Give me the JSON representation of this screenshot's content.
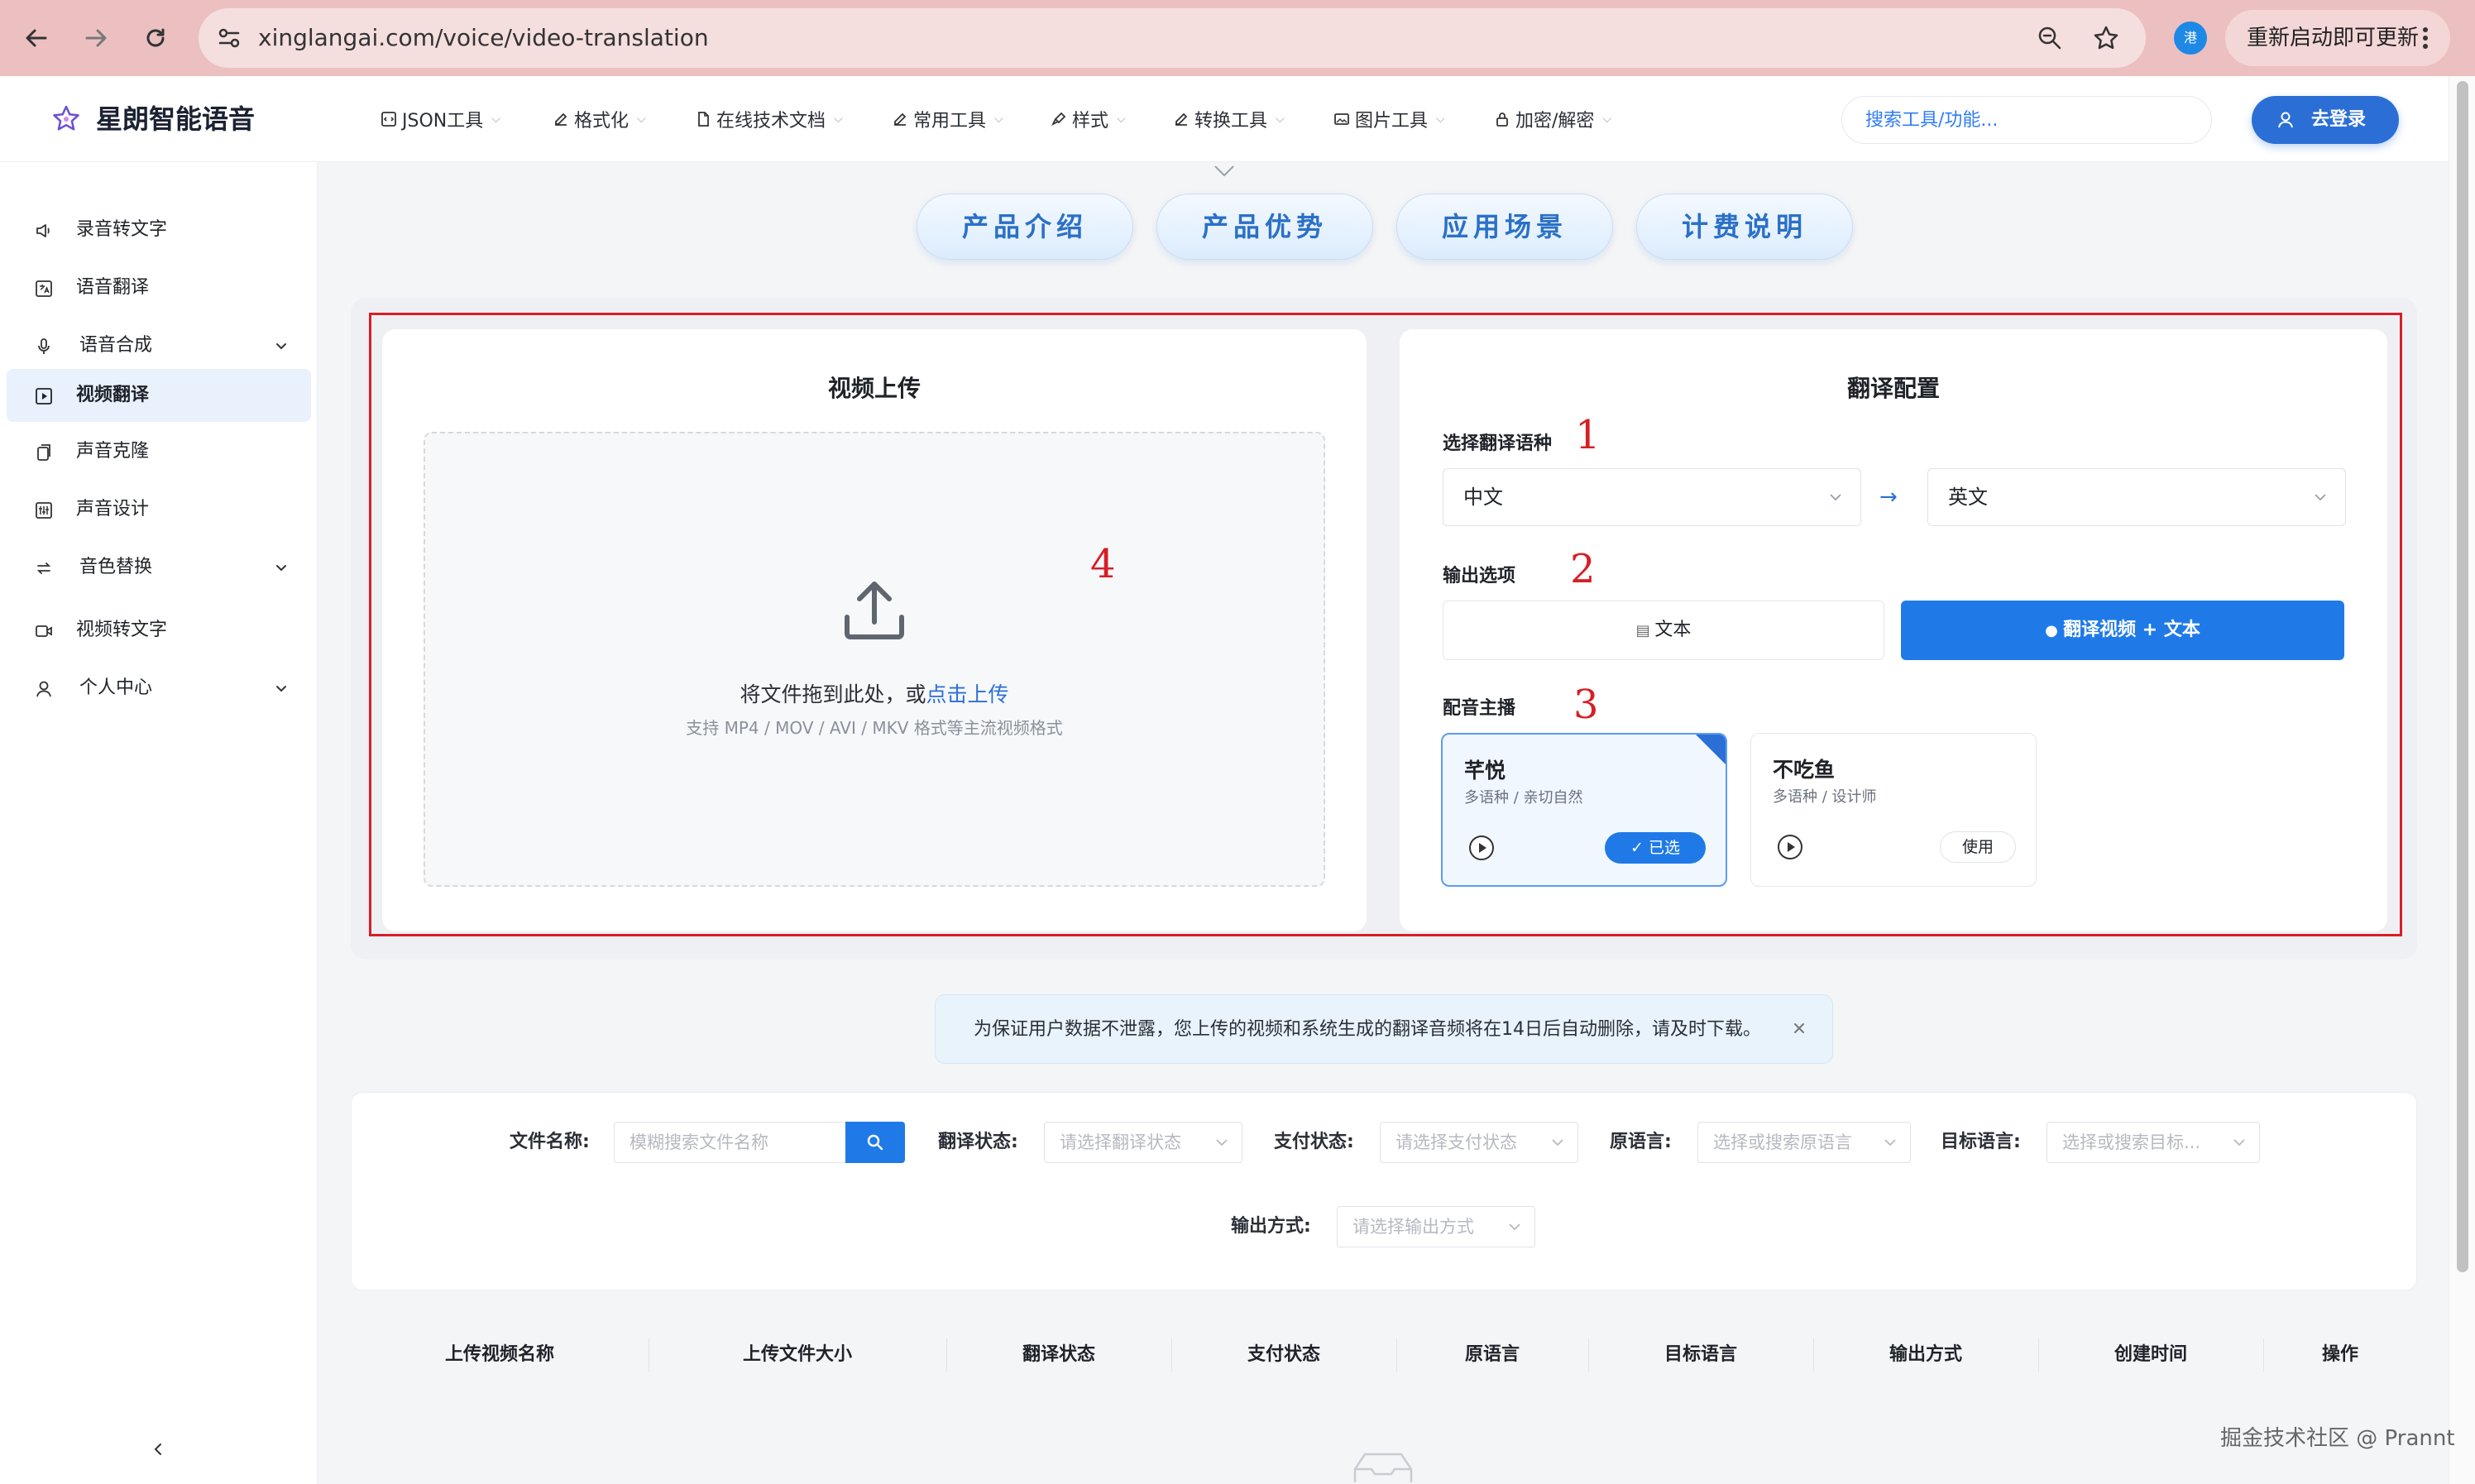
{
  "browser": {
    "url": "xinglangai.com/voice/video-translation",
    "update_button": "重新启动即可更新",
    "profile_initial": "港"
  },
  "header": {
    "brand": "星朗智能语音",
    "menu": [
      {
        "label": "JSON工具",
        "icon": "code-box-icon"
      },
      {
        "label": "格式化",
        "icon": "edit-icon"
      },
      {
        "label": "在线技术文档",
        "icon": "document-icon"
      },
      {
        "label": "常用工具",
        "icon": "edit-icon"
      },
      {
        "label": "样式",
        "icon": "brush-icon"
      },
      {
        "label": "转换工具",
        "icon": "edit-icon"
      },
      {
        "label": "图片工具",
        "icon": "image-icon"
      },
      {
        "label": "加密/解密",
        "icon": "lock-icon"
      }
    ],
    "search_placeholder": "搜索工具/功能...",
    "login": "去登录"
  },
  "sidebar": {
    "items": [
      {
        "label": "录音转文字",
        "icon": "speaker-icon"
      },
      {
        "label": "语音翻译",
        "icon": "translate-icon"
      },
      {
        "label": "语音合成",
        "icon": "microphone-icon",
        "expandable": true
      },
      {
        "label": "视频翻译",
        "icon": "video-play-icon",
        "active": true
      },
      {
        "label": "声音克隆",
        "icon": "copy-icon"
      },
      {
        "label": "声音设计",
        "icon": "sliders-icon"
      },
      {
        "label": "音色替换",
        "icon": "swap-icon",
        "expandable": true
      },
      {
        "label": "视频转文字",
        "icon": "video-camera-icon"
      },
      {
        "label": "个人中心",
        "icon": "user-icon",
        "expandable": true
      }
    ]
  },
  "tabs": [
    "产品介绍",
    "产品优势",
    "应用场景",
    "计费说明"
  ],
  "upload": {
    "title": "视频上传",
    "drop_text": "将文件拖到此处，或",
    "drop_link": "点击上传",
    "hint": "支持 MP4 / MOV / AVI / MKV 格式等主流视频格式"
  },
  "config": {
    "title": "翻译配置",
    "language_label": "选择翻译语种",
    "source_lang": "中文",
    "target_lang": "英文",
    "output_label": "输出选项",
    "output_text": "文本",
    "output_video": "翻译视频 + 文本",
    "voice_label": "配音主播",
    "voices": [
      {
        "name": "芊悦",
        "desc": "多语种 / 亲切自然",
        "action": "已选",
        "selected": true
      },
      {
        "name": "不吃鱼",
        "desc": "多语种 / 设计师",
        "action": "使用",
        "selected": false
      }
    ]
  },
  "annotations": [
    "1",
    "2",
    "3",
    "4"
  ],
  "notice": "为保证用户数据不泄露，您上传的视频和系统生成的翻译音频将在14日后自动删除，请及时下载。",
  "filters": {
    "file_name_label": "文件名称:",
    "file_name_placeholder": "模糊搜索文件名称",
    "status_label": "翻译状态:",
    "status_placeholder": "请选择翻译状态",
    "pay_label": "支付状态:",
    "pay_placeholder": "请选择支付状态",
    "source_label": "原语言:",
    "source_placeholder": "选择或搜索原语言",
    "target_label": "目标语言:",
    "target_placeholder": "选择或搜索目标...",
    "output_label": "输出方式:",
    "output_placeholder": "请选择输出方式"
  },
  "table": {
    "columns": [
      "上传视频名称",
      "上传文件大小",
      "翻译状态",
      "支付状态",
      "原语言",
      "目标语言",
      "输出方式",
      "创建时间",
      "操作"
    ]
  },
  "watermark": "掘金技术社区 @ Prannt"
}
